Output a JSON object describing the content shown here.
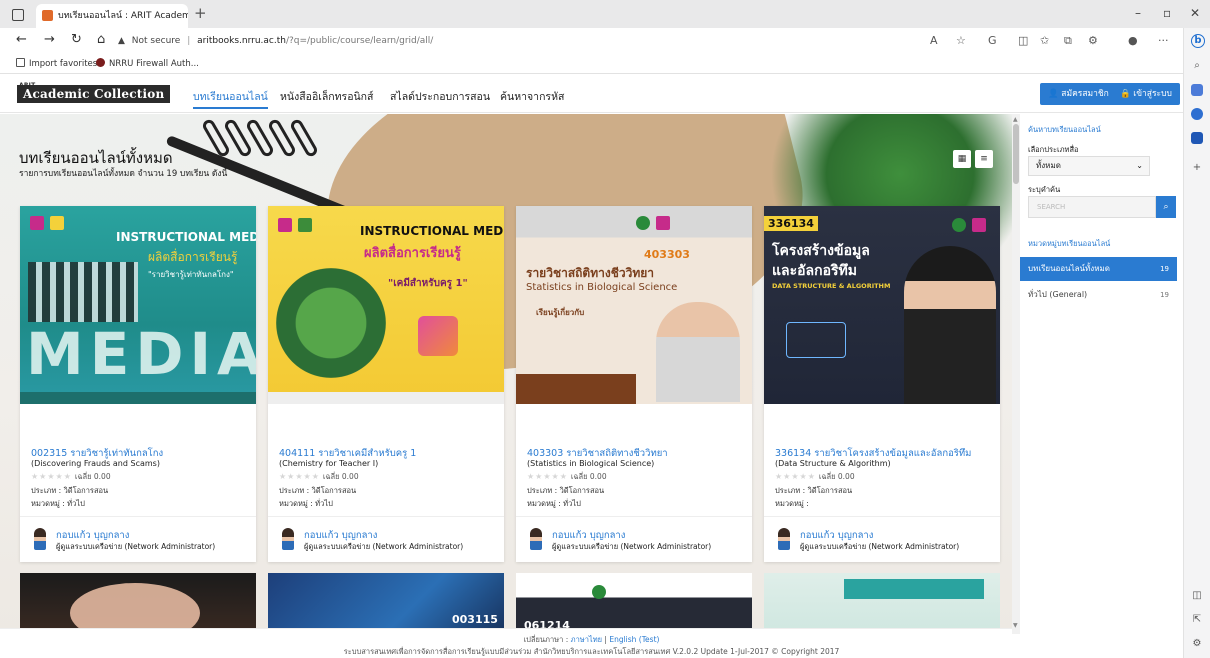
{
  "browser": {
    "tab_title": "บทเรียนออนไลน์ : ARIT Academic C...",
    "url_warning": "Not secure",
    "url_host": "aritbooks.nrru.ac.th",
    "url_path": "/?q=/public/course/learn/grid/all/",
    "favorites": [
      "Import favorites",
      "NRRU Firewall Auth..."
    ]
  },
  "site": {
    "logo_sup": "ARIT",
    "logo": "Academic Collection",
    "nav": [
      "บทเรียนออนไลน์",
      "หนังสืออิเล็กทรอนิกส์",
      "สไลด์ประกอบการสอน",
      "ค้นหาจากรหัส"
    ],
    "register_label": "สมัครสมาชิก",
    "login_label": "เข้าสู่ระบบ"
  },
  "main": {
    "title": "บทเรียนออนไลน์ทั้งหมด",
    "subtitle": "รายการบทเรียนออนไลน์ทั้งหมด จำนวน 19 บทเรียน ดังนี้",
    "courses": [
      {
        "img_title": "INSTRUCTIONAL MEDIA",
        "img_sub": "ผลิตสื่อการเรียนรู้",
        "img_extra": "\"รายวิชารู้เท่าทันกลโกง\"",
        "img_code": "",
        "title": "002315 รายวิชารู้เท่าทันกลโกง",
        "en": "(Discovering Frauds and Scams)",
        "rating": "เฉลี่ย 0.00",
        "type": "ประเภท : วิดีโอการสอน",
        "category": "หมวดหมู่ : ทั่วไป",
        "author": "กอบแก้ว บุญกลาง",
        "role": "ผู้ดูแลระบบเครือข่าย (Network Administrator)"
      },
      {
        "img_title": "INSTRUCTIONAL MEDIA",
        "img_sub": "ผลิตสื่อการเรียนรู้",
        "img_extra": "\"เคมีสำหรับครู 1\"",
        "img_code": "",
        "title": "404111 รายวิชาเคมีสำหรับครู 1",
        "en": "(Chemistry for Teacher I)",
        "rating": "เฉลี่ย 0.00",
        "type": "ประเภท : วิดีโอการสอน",
        "category": "หมวดหมู่ : ทั่วไป",
        "author": "กอบแก้ว บุญกลาง",
        "role": "ผู้ดูแลระบบเครือข่าย (Network Administrator)"
      },
      {
        "img_title": "รายวิชาสถิติทางชีววิทยา",
        "img_sub": "Statistics in Biological Science",
        "img_extra": "เรียนรู้เกี่ยวกับ",
        "img_code": "403303",
        "title": "403303 รายวิชาสถิติทางชีววิทยา",
        "en": "(Statistics in Biological Science)",
        "rating": "เฉลี่ย 0.00",
        "type": "ประเภท : วิดีโอการสอน",
        "category": "หมวดหมู่ : ทั่วไป",
        "author": "กอบแก้ว บุญกลาง",
        "role": "ผู้ดูแลระบบเครือข่าย (Network Administrator)"
      },
      {
        "img_title": "โครงสร้างข้อมูล",
        "img_sub": "และอัลกอริทึม",
        "img_extra": "DATA STRUCTURE & ALGORITHM",
        "img_code": "336134",
        "title": "336134 รายวิชาโครงสร้างข้อมูลและอัลกอริทึม",
        "en": "(Data Structure & Algorithm)",
        "rating": "เฉลี่ย 0.00",
        "type": "ประเภท : วิดีโอการสอน",
        "category": "หมวดหมู่ :",
        "author": "กอบแก้ว บุญกลาง",
        "role": "ผู้ดูแลระบบเครือข่าย (Network Administrator)"
      }
    ],
    "row2_codes": [
      "",
      "003115",
      "061214",
      ""
    ]
  },
  "sidebar": {
    "search_heading": "ค้นหาบทเรียนออนไลน์",
    "type_label": "เลือกประเภทสื่อ",
    "type_value": "ทั้งหมด",
    "keyword_label": "ระบุคำค้น",
    "search_placeholder": "SEARCH",
    "categories_heading": "หมวดหมู่บทเรียนออนไลน์",
    "categories": [
      {
        "label": "บทเรียนออนไลน์ทั้งหมด",
        "count": "19"
      },
      {
        "label": "ทั่วไป (General)",
        "count": "19"
      }
    ]
  },
  "footer": {
    "lang_prefix": "เปลี่ยนภาษา :",
    "lang_th": "ภาษาไทย",
    "lang_en": "English (Test)",
    "copyright": "ระบบสารสนเทศเพื่อการจัดการสื่อการเรียนรู้แบบมีส่วนร่วม สำนักวิทยบริการและเทคโนโลยีสารสนเทศ V.2.0.2 Update 1-Jul-2017 © Copyright 2017"
  },
  "colors": {
    "accent": "#2a7bd1",
    "teal": "#1f8c8a",
    "yellow": "#f4d13a",
    "dark": "#232a3a"
  }
}
